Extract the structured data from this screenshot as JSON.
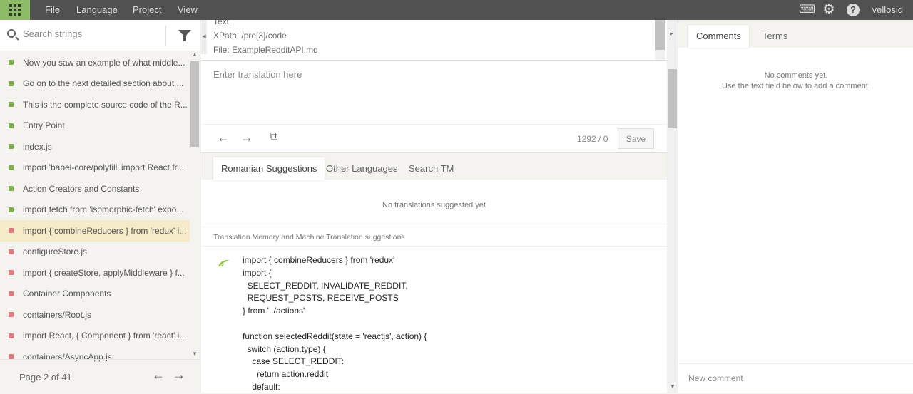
{
  "menu": {
    "items": [
      "File",
      "Language",
      "Project",
      "View"
    ],
    "user": "vellosid"
  },
  "sidebar": {
    "search_placeholder": "Search strings",
    "items": [
      {
        "label": "Now you saw an example of what middle...",
        "status": "translated"
      },
      {
        "label": "Go on to the next detailed section about ...",
        "status": "translated"
      },
      {
        "label": "This is the complete source code of the R...",
        "status": "translated"
      },
      {
        "label": "Entry Point",
        "status": "translated"
      },
      {
        "label": "index.js",
        "status": "translated"
      },
      {
        "label": "import 'babel-core/polyfill' import React fr...",
        "status": "translated"
      },
      {
        "label": "Action Creators and Constants",
        "status": "translated"
      },
      {
        "label": "import fetch from 'isomorphic-fetch' expo...",
        "status": "translated"
      },
      {
        "label": "import { combineReducers } from 'redux' i...",
        "status": "untranslated",
        "selected": true
      },
      {
        "label": "configureStore.js",
        "status": "untranslated"
      },
      {
        "label": "import { createStore, applyMiddleware } f...",
        "status": "untranslated"
      },
      {
        "label": "Container Components",
        "status": "untranslated"
      },
      {
        "label": "containers/Root.js",
        "status": "untranslated"
      },
      {
        "label": "import React, { Component } from 'react' i...",
        "status": "untranslated"
      },
      {
        "label": "containers/AsyncApp.js",
        "status": "untranslated"
      }
    ],
    "pagination": "Page 2 of 41"
  },
  "source": {
    "label": "Text",
    "xpath": "XPath: /pre[3]/code",
    "file_label": "File: ",
    "file": "ExampleRedditAPI.md"
  },
  "editor": {
    "placeholder": "Enter translation here",
    "count": "1292 / 0",
    "save": "Save"
  },
  "suggestions": {
    "tabs": [
      "Romanian Suggestions",
      "Other Languages",
      "Search TM"
    ],
    "empty": "No translations suggested yet",
    "tm_header": "Translation Memory and Machine Translation suggestions",
    "tm_text": "import { combineReducers } from 'redux'\nimport {\n  SELECT_REDDIT, INVALIDATE_REDDIT,\n  REQUEST_POSTS, RECEIVE_POSTS\n} from '../actions'\n\nfunction selectedReddit(state = 'reactjs', action) {\n  switch (action.type) {\n    case SELECT_REDDIT:\n      return action.reddit\n    default:"
  },
  "comments": {
    "tabs": [
      "Comments",
      "Terms"
    ],
    "empty1": "No comments yet.",
    "empty2": "Use the text field below to add a comment.",
    "placeholder": "New comment"
  },
  "colors": {
    "topbar": "#515151",
    "accent": "#8dbb67",
    "translated": "#7fae4f",
    "untranslated": "#e07a80",
    "selected": "#f5ebc8"
  }
}
